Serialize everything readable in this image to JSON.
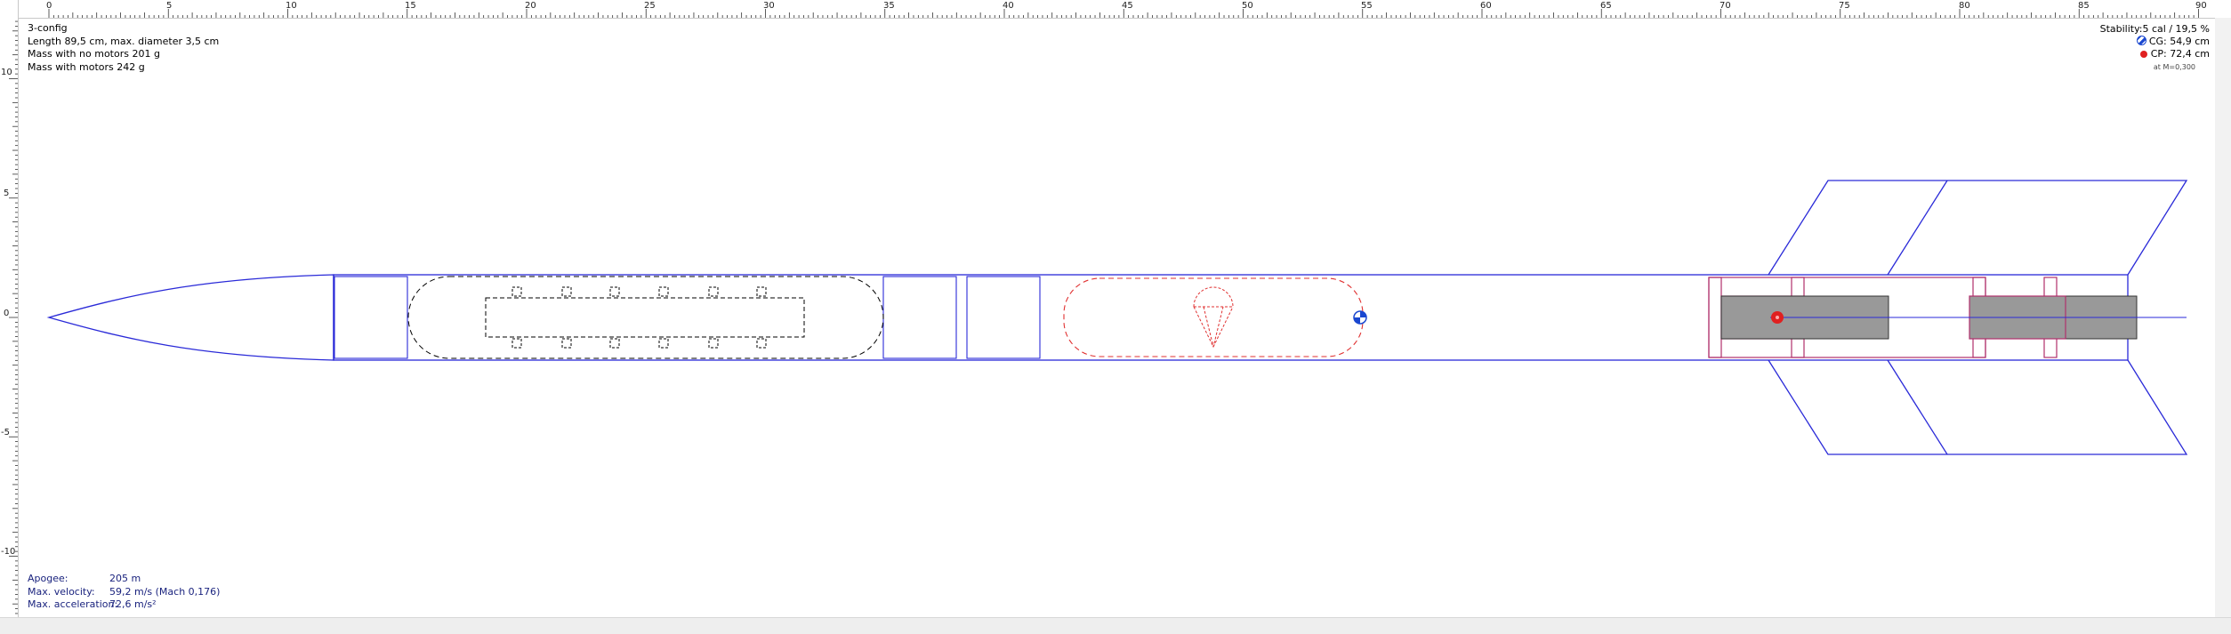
{
  "design": {
    "name": "3-config",
    "length_line": "Length 89,5 cm, max. diameter 3,5 cm",
    "mass_no_motors": "Mass with no motors 201 g",
    "mass_with_motors": "Mass with motors 242 g"
  },
  "stability": {
    "stability": "Stability:5 cal / 19,5 %",
    "cg": "CG: 54,9 cm",
    "cp": "CP: 72,4 cm",
    "mach": "at M=0,300"
  },
  "flight": {
    "apogee_label": "Apogee:",
    "apogee_value": "205 m",
    "velocity_label": "Max. velocity:",
    "velocity_value": "59,2 m/s  (Mach 0,176)",
    "accel_label": "Max. acceleration:",
    "accel_value": "72,6 m/s²"
  },
  "ruler": {
    "unit": "cm",
    "top_labels": [
      "0",
      "5",
      "10",
      "15",
      "20",
      "25",
      "30",
      "35",
      "40",
      "45",
      "50",
      "55",
      "60",
      "65",
      "70",
      "75",
      "80",
      "85",
      "90"
    ],
    "left_labels": [
      "10",
      "5",
      "0",
      "-5",
      "-10"
    ]
  },
  "colors": {
    "outline": "#2a2ad8",
    "recovery": "#e03030",
    "motor_mount": "#b0306c",
    "motor_fill": "#999999",
    "cg_color": "#1a47d0",
    "cp_color": "#e02020"
  }
}
